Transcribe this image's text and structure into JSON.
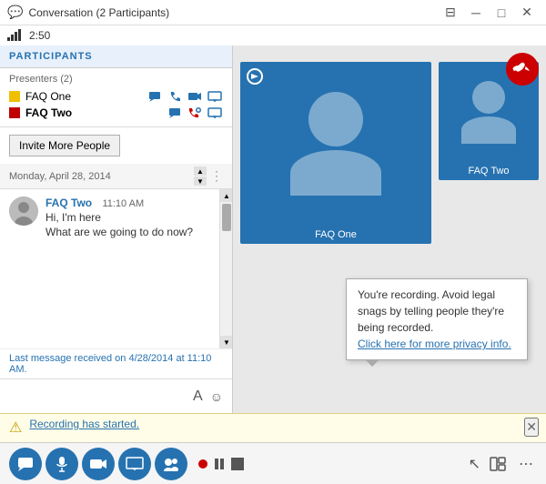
{
  "titleBar": {
    "icon": "💬",
    "title": "Conversation (2 Participants)",
    "controls": [
      "⊟",
      "─",
      "□",
      "✕"
    ]
  },
  "signalBar": {
    "time": "2:50"
  },
  "participants": {
    "header": "PARTICIPANTS",
    "presentersLabel": "Presenters (2)",
    "list": [
      {
        "name": "FAQ One",
        "color": "#f0c000",
        "bold": false
      },
      {
        "name": "FAQ Two",
        "color": "#c00000",
        "bold": true
      }
    ]
  },
  "inviteButton": "Invite More People",
  "chat": {
    "dateHeader": "Monday, April 28, 2014",
    "message": {
      "sender": "FAQ Two",
      "time": "11:10 AM",
      "lines": [
        "Hi, I'm here",
        "What are we going to do now?"
      ]
    },
    "footer": "Last message received on 4/28/2014 at 11:10 AM."
  },
  "video": {
    "participants": [
      {
        "name": "FAQ One",
        "isMain": true
      },
      {
        "name": "FAQ Two",
        "isMain": false
      }
    ]
  },
  "tooltip": {
    "line1": "You're recording. Avoid legal snags by telling",
    "line2": "people they're being recorded.",
    "link": "Click here for more privacy info."
  },
  "recordingBar": {
    "text": "Recording has started."
  },
  "toolbar": {
    "buttons": [
      {
        "label": "💬",
        "type": "dark",
        "name": "chat-button"
      },
      {
        "label": "🎤",
        "type": "dark",
        "name": "mic-button"
      },
      {
        "label": "📷",
        "type": "dark",
        "name": "camera-button"
      },
      {
        "label": "🖥",
        "type": "dark",
        "name": "screen-button"
      },
      {
        "label": "👥",
        "type": "dark",
        "name": "participants-button"
      }
    ],
    "rightButtons": [
      {
        "label": "⊞",
        "name": "layout-button"
      },
      {
        "label": "⋯",
        "name": "more-button"
      }
    ]
  },
  "colors": {
    "accent": "#2672b0",
    "endCall": "#c00000",
    "recording": "#c00000",
    "tooltipBg": "#fffde7"
  }
}
